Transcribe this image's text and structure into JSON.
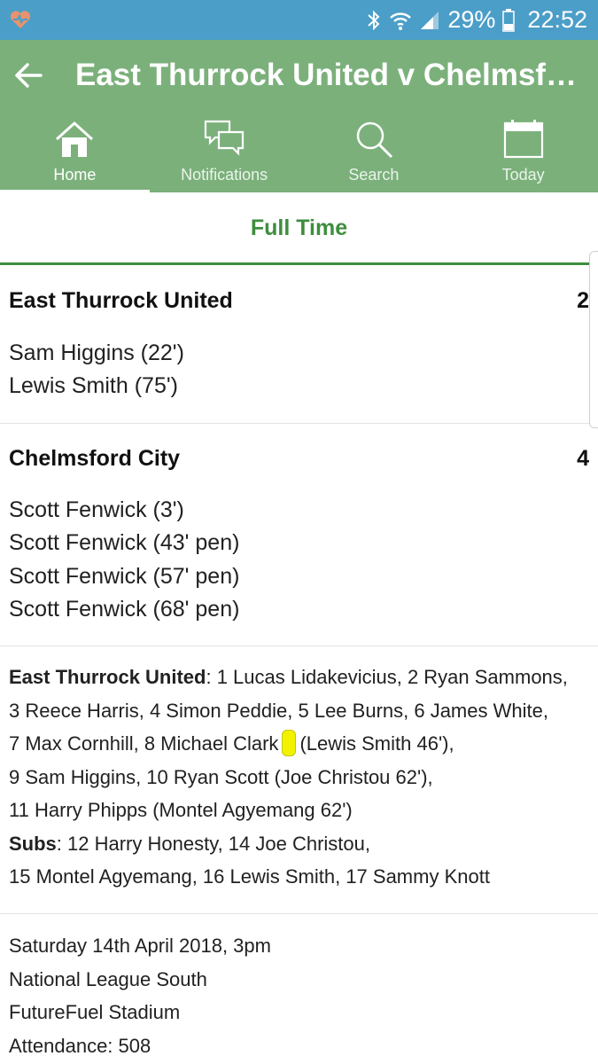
{
  "status_bar": {
    "battery": "29%",
    "time": "22:52",
    "icons": [
      "health-heart-icon",
      "bluetooth-icon",
      "wifi-icon",
      "signal-icon",
      "battery-icon"
    ]
  },
  "header": {
    "title": "East Thurrock United v Chelmsford City",
    "back_icon": "arrow-left-icon"
  },
  "nav": [
    {
      "label": "Home",
      "icon": "home-icon",
      "active": true
    },
    {
      "label": "Notifications",
      "icon": "chat-bubbles-icon",
      "active": false
    },
    {
      "label": "Search",
      "icon": "search-icon",
      "active": false
    },
    {
      "label": "Today",
      "icon": "calendar-icon",
      "active": false
    }
  ],
  "match_status": "Full Time",
  "home": {
    "name": "East Thurrock United",
    "score": "2",
    "scorers": [
      "Sam Higgins (22')",
      "Lewis Smith (75')"
    ]
  },
  "away": {
    "name": "Chelmsford City",
    "score": "4",
    "scorers": [
      "Scott Fenwick (3')",
      "Scott Fenwick (43' pen)",
      "Scott Fenwick (57' pen)",
      "Scott Fenwick (68' pen)"
    ]
  },
  "lineup": {
    "team": "East Thurrock United",
    "l1": ": 1 Lucas Lidakevicius, 2 Ryan Sammons,",
    "l2": "3 Reece Harris, 4 Simon Peddie, 5 Lee Burns, 6 James White,",
    "l3a": "7 Max Cornhill, 8 Michael Clark",
    "l3b": "(Lewis Smith 46'),",
    "l4": "9 Sam Higgins, 10 Ryan Scott (Joe Christou 62'),",
    "l5": "11 Harry Phipps (Montel Agyemang 62')",
    "subs_label": "Subs",
    "subs1": ": 12 Harry Honesty, 14 Joe Christou,",
    "subs2": "15 Montel Agyemang, 16 Lewis Smith, 17 Sammy Knott",
    "card_color": "#f2f200"
  },
  "info": {
    "date": "Saturday 14th April 2018, 3pm",
    "league": "National League South",
    "venue": "FutureFuel Stadium",
    "attendance": "Attendance: 508"
  },
  "colors": {
    "status_bar": "#4b9ec8",
    "app_bar": "#7bb07b",
    "accent": "#3e8e3e"
  }
}
